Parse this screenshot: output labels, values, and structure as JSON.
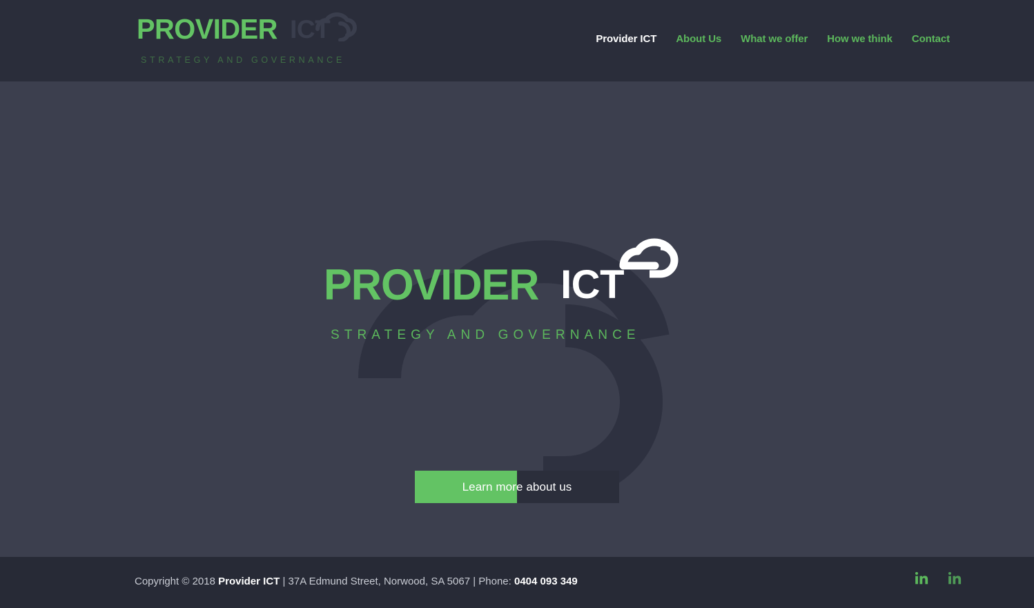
{
  "header": {
    "brand": {
      "word": "PROVIDER",
      "ict": "ICT",
      "tagline": "STRATEGY AND GOVERNANCE",
      "cloud_icon": "cloud-mark-icon"
    },
    "nav": [
      {
        "label": "Provider ICT",
        "active": true
      },
      {
        "label": "About Us",
        "active": false
      },
      {
        "label": "What we offer",
        "active": false
      },
      {
        "label": "How we think",
        "active": false
      },
      {
        "label": "Contact",
        "active": false
      }
    ]
  },
  "hero": {
    "logo": {
      "word": "PROVIDER",
      "ict": "ICT",
      "tagline": "STRATEGY AND GOVERNANCE",
      "cloud_icon": "cloud-mark-icon",
      "watermark_icon": "cloud-watermark-icon"
    },
    "cta": {
      "label": "Learn more about us",
      "fill_percent": 50
    }
  },
  "footer": {
    "copyright_prefix": "Copyright © 2018 ",
    "company": "Provider ICT",
    "address": " | 37A Edmund Street, Norwood, SA 5067 | Phone: ",
    "phone": "0404 093 349",
    "social": [
      {
        "name": "linkedin",
        "label": "in"
      },
      {
        "name": "linkedin",
        "label": "in"
      }
    ]
  },
  "colors": {
    "green": "#63c364",
    "nav_green": "#5cb85c",
    "header_bg": "#2a2d3a",
    "hero_bg": "#3c3f4e",
    "footer_bg": "#272a36",
    "button_dark": "#2b2e3b",
    "watermark": "#2e3140"
  }
}
